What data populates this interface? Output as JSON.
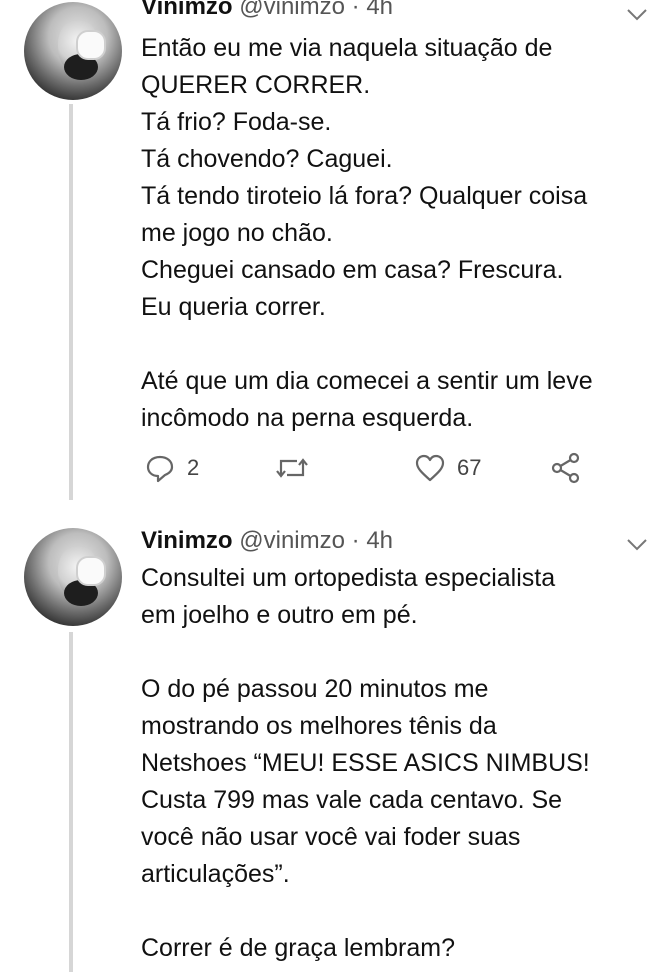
{
  "tweets": [
    {
      "name": "Vinimzo",
      "handle": "@vinimzo",
      "separator": "·",
      "time": "4h",
      "text": "Então eu me via naquela situação de\nQUERER CORRER.\nTá frio? Foda-se.\nTá chovendo? Caguei.\nTá tendo tiroteio lá fora? Qualquer coisa\nme jogo no chão.\nCheguei cansado em casa? Frescura.\nEu queria correr.\n\nAté que um dia comecei a sentir um leve\nincômodo na perna esquerda.",
      "reply_count": "2",
      "like_count": "67",
      "icons": [
        "reply-icon",
        "retweet-icon",
        "like-icon",
        "share-icon",
        "chevron-down-icon"
      ]
    },
    {
      "name": "Vinimzo",
      "handle": "@vinimzo",
      "separator": "·",
      "time": "4h",
      "text": "Consultei um ortopedista especialista\nem joelho e outro em pé.\n\nO do pé passou 20 minutos me\nmostrando os melhores tênis da\nNetshoes “MEU! ESSE ASICS NIMBUS!\nCusta 799 mas vale cada centavo. Se\nvocê não usar você vai foder suas\narticulações”.\n\nCorrer é de graça lembram?",
      "icons": [
        "chevron-down-icon"
      ]
    }
  ],
  "colors": {
    "text": "#111111",
    "muted": "#555555",
    "thread_line": "#d6d6d6",
    "icon": "#666666"
  }
}
